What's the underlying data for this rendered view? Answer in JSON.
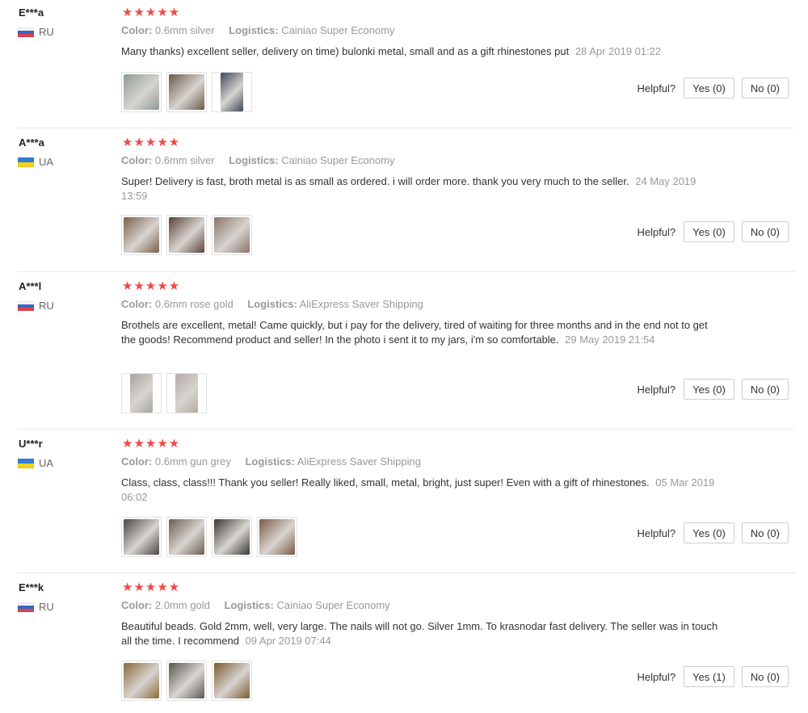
{
  "labels": {
    "color": "Color:",
    "logistics": "Logistics:",
    "helpful": "Helpful?"
  },
  "reviews": [
    {
      "user": "E***a",
      "country": "RU",
      "flag": "ru",
      "stars": "★★★★★",
      "color": "0.6mm silver",
      "logistics": "Cainiao Super Economy",
      "text": "Many thanks) excellent seller, delivery on time) bulonki metal, small and as a gift rhinestones put",
      "date": "28 Apr 2019 01:22",
      "photos": [
        "#8f9a94",
        "#6a5a4a",
        "#3c4658"
      ],
      "yes": "Yes (0)",
      "no": "No (0)"
    },
    {
      "user": "A***a",
      "country": "UA",
      "flag": "ua",
      "stars": "★★★★★",
      "color": "0.6mm silver",
      "logistics": "Cainiao Super Economy",
      "text": "Super! Delivery is fast, broth metal is as small as ordered. i will order more. thank you very much to the seller.",
      "date": "24 May 2019 13:59",
      "photos": [
        "#7a5f4a",
        "#5a4238",
        "#8a7268"
      ],
      "yes": "Yes (0)",
      "no": "No (0)"
    },
    {
      "user": "A***l",
      "country": "RU",
      "flag": "ru",
      "stars": "★★★★★",
      "color": "0.6mm rose gold",
      "logistics": "AliExpress Saver Shipping",
      "text": "Brothels are excellent, metal! Came quickly, but i pay for the delivery, tired of waiting for three months and in the end not to get the goods! Recommend product and seller! In the photo i sent it to my jars, i'm so comfortable.",
      "date": "29 May 2019 21:54",
      "photos": [
        "#a8a4a0",
        "#b4aaa4"
      ],
      "yes": "Yes (0)",
      "no": "No (0)"
    },
    {
      "user": "U***r",
      "country": "UA",
      "flag": "ua",
      "stars": "★★★★★",
      "color": "0.6mm gun grey",
      "logistics": "AliExpress Saver Shipping",
      "text": "Class, class, class!!! Thank you seller! Really liked, small, metal, bright, just super! Even with a gift of rhinestones.",
      "date": "05 Mar 2019 06:02",
      "photos": [
        "#4a4442",
        "#6a5e50",
        "#3a3634",
        "#7a5a48"
      ],
      "yes": "Yes (0)",
      "no": "No (0)"
    },
    {
      "user": "E***k",
      "country": "RU",
      "flag": "ru",
      "stars": "★★★★★",
      "color": "2.0mm gold",
      "logistics": "Cainiao Super Economy",
      "text": "Beautiful beads. Gold 2mm, well, very large. The nails will not go. Silver 1mm. To krasnodar fast delivery. The seller was in touch all the time. I recommend",
      "date": "09 Apr 2019 07:44",
      "photos": [
        "#8a6a3a",
        "#5a5650",
        "#7a5a30"
      ],
      "yes": "Yes (1)",
      "no": "No (0)"
    }
  ]
}
